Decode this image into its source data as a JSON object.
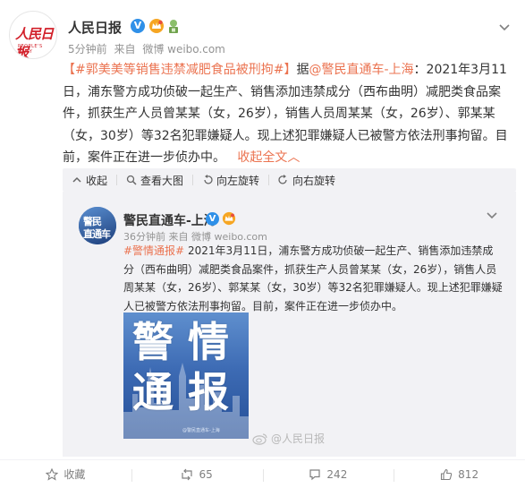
{
  "post": {
    "author": "人民日报",
    "time": "5分钟前",
    "source_prefix": "来自",
    "source": "微博 weibo.com",
    "avatar_logo": "人民日报",
    "avatar_sub": "PEOPLE'S DAILY",
    "hashtag": "【#郭美美等销售违禁减肥食品被刑拘#】",
    "text_pre": "据",
    "mention": "@警民直通车-上海",
    "body": "：2021年3月11日，浦东警方成功侦破一起生产、销售添加违禁成分（西布曲明）减肥类食品案件，抓获生产人员曾某某（女，26岁），销售人员周某某（女，26岁）、郭某某（女，30岁）等32名犯罪嫌疑人。现上述犯罪嫌疑人已被警方依法刑事拘留。目前，案件正在进一步侦办中。",
    "expand_label": "收起全文",
    "expand_arrow": "︿"
  },
  "toolbar": {
    "collapse": "收起",
    "view_large": "查看大图",
    "rotate_left": "向左旋转",
    "rotate_right": "向右旋转"
  },
  "repost": {
    "author": "警民直通车-上海",
    "time": "36分钟前",
    "source_prefix": "来自",
    "source": "微博 weibo.com",
    "avatar_line1": "警民",
    "avatar_line2": "直通车",
    "hashtag": "#警情通报#",
    "body": " 2021年3月11日，浦东警方成功侦破一起生产、销售添加违禁成分（西布曲明）减肥类食品案件，抓获生产人员曾某某（女，26岁），销售人员周某某（女，26岁）、郭某某（女，30岁）等32名犯罪嫌疑人。现上述犯罪嫌疑人已被警方依法刑事拘留。目前，案件正在进一步侦办中。",
    "image_chars": [
      "警",
      "情",
      "通",
      "报"
    ],
    "image_caption": "@警民直通车-上海",
    "watermark": "@人民日报"
  },
  "actions": {
    "favorite": "收藏",
    "repost_count": "65",
    "comment_count": "242",
    "like_count": "812"
  },
  "colors": {
    "accent": "#eb7350",
    "verified": "#2f90e8",
    "brand_red": "#d2202a"
  }
}
